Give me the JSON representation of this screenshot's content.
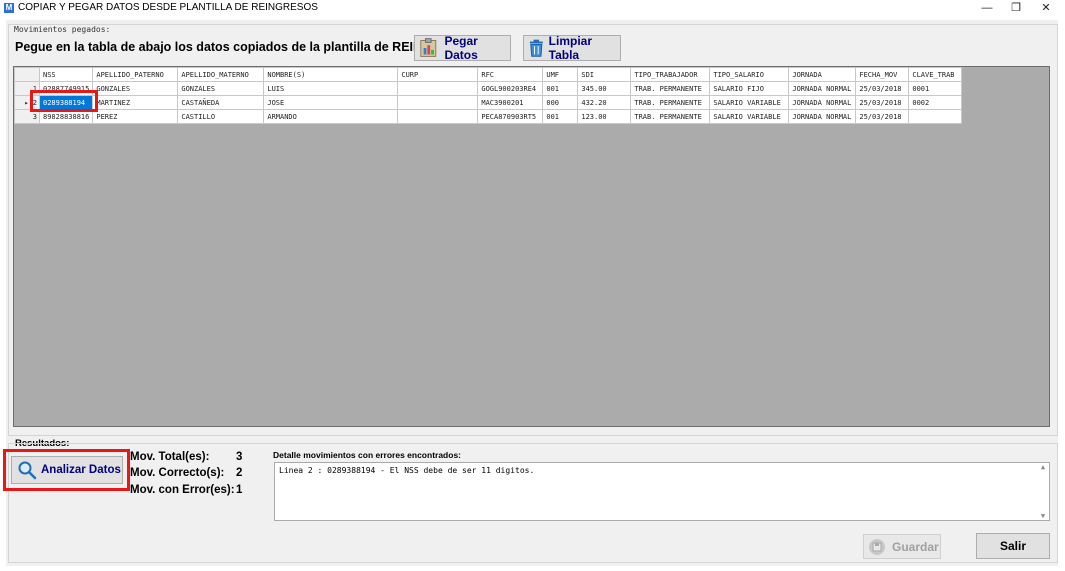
{
  "window": {
    "title": "COPIAR Y PEGAR DATOS DESDE PLANTILLA DE REINGRESOS",
    "icon": "M",
    "minimize_glyph": "—",
    "restore_glyph": "❐",
    "close_glyph": "✕"
  },
  "pasted_group": {
    "label": "Movimientos pegados:",
    "instruction": "Pegue en la tabla de abajo los datos copiados de la plantilla de REINGRESOS.",
    "paste_button": "Pegar Datos",
    "clear_button": "Limpiar Tabla"
  },
  "grid": {
    "columns": [
      "NSS",
      "APELLIDO_PATERNO",
      "APELLIDO_MATERNO",
      "NOMBRE(S)",
      "CURP",
      "RFC",
      "UMF",
      "SDI",
      "TIPO_TRABAJADOR",
      "TIPO_SALARIO",
      "JORNADA",
      "FECHA_MOV",
      "CLAVE_TRAB"
    ],
    "rows": [
      {
        "num": "1",
        "marker": "",
        "cells": [
          "02887749915",
          "GONZALES",
          "GONZALES",
          "LUIS",
          "",
          "GOGL900203RE4",
          "001",
          "345.00",
          "TRAB. PERMANENTE",
          "SALARIO FIJO",
          "JORNADA NORMAL",
          "25/03/2018",
          "0001"
        ]
      },
      {
        "num": "2",
        "marker": "▸",
        "cells": [
          "0289388194",
          "MARTINEZ",
          "CASTAÑEDA",
          "JOSE",
          "",
          "MAC3900201",
          "000",
          "432.20",
          "TRAB. PERMANENTE",
          "SALARIO VARIABLE",
          "JORNADA NORMAL",
          "25/03/2018",
          "0002"
        ]
      },
      {
        "num": "3",
        "marker": "",
        "cells": [
          "89828838816",
          "PEREZ",
          "CASTILLO",
          "ARMANDO",
          "",
          "PECA870903RT5",
          "001",
          "123.00",
          "TRAB. PERMANENTE",
          "SALARIO VARIABLE",
          "JORNADA NORMAL",
          "25/03/2018",
          ""
        ]
      }
    ]
  },
  "results": {
    "label": "Resultados:",
    "analyze_button": "Analizar Datos",
    "total_label": "Mov. Total(es):",
    "total_value": "3",
    "correct_label": "Mov. Correcto(s):",
    "correct_value": "2",
    "error_label": "Mov. con Error(es):",
    "error_value": "1",
    "detail_label": "Detalle movimientos con errores encontrados:",
    "detail_text": "Linea 2 : 0289388194 - El NSS debe de ser 11 digitos."
  },
  "footer": {
    "save_button": "Guardar",
    "exit_button": "Salir"
  },
  "colors": {
    "highlight": "#e81818",
    "selection": "#0078d7",
    "button_text": "#000080"
  }
}
